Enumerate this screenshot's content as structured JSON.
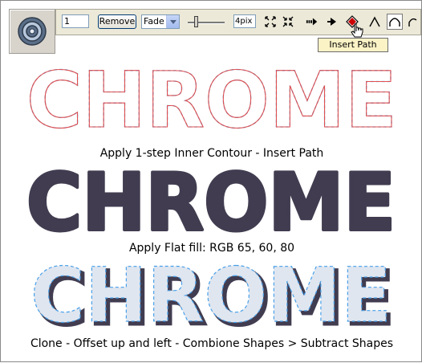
{
  "toolbar": {
    "steps_value": "1",
    "remove_label": "Remove",
    "type_select": "Fade",
    "width_value": "4pix",
    "tooltip": "Insert Path"
  },
  "artwork": {
    "word": "CHROME",
    "colors": {
      "outline_red": "#e05050",
      "outline_blue": "#4aa0e8",
      "flat_fill": "#413c50",
      "bevel_light": "#dfe6f0",
      "bevel_dark": "#413c50"
    }
  },
  "captions": {
    "step1": "Apply 1-step Inner Contour - Insert Path",
    "step2": "Apply Flat fill: RGB 65, 60, 80",
    "step3": "Clone - Offset up and left - Combione Shapes > Subtract Shapes"
  },
  "icons": [
    "contour-tool-icon",
    "fit-to-window-icon",
    "fit-inward-icon",
    "arrow-steps-icon",
    "arrow-single-icon",
    "insert-path-icon",
    "sharp-join-icon",
    "round-join-icon",
    "mouse-cursor-icon"
  ]
}
